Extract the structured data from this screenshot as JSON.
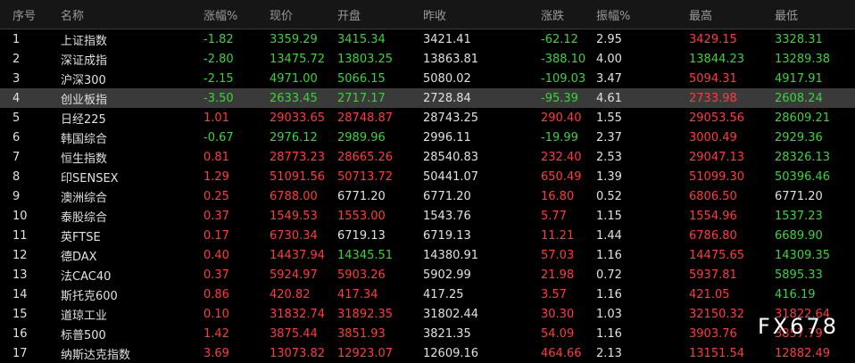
{
  "headers": [
    "序号",
    "名称",
    "涨幅%",
    "现价",
    "开盘",
    "昨收",
    "涨跌",
    "振幅%",
    "最高",
    "最低"
  ],
  "colors": {
    "up": "#ff3b3b",
    "down": "#3cd23c",
    "flat": "#e0e0e0",
    "selected_row": "#3a3a3a"
  },
  "watermark": "FX678",
  "rows": [
    {
      "idx": "1",
      "name": "上证指数",
      "chg": "-1.82",
      "price": "3359.29",
      "open": "3415.34",
      "prev": "3421.41",
      "diff": "-62.12",
      "amp": "2.95",
      "high": "3429.15",
      "low": "3328.31"
    },
    {
      "idx": "2",
      "name": "深证成指",
      "chg": "-2.80",
      "price": "13475.72",
      "open": "13803.25",
      "prev": "13863.81",
      "diff": "-388.10",
      "amp": "4.00",
      "high": "13844.23",
      "low": "13289.38"
    },
    {
      "idx": "3",
      "name": "沪深300",
      "chg": "-2.15",
      "price": "4971.00",
      "open": "5066.15",
      "prev": "5080.02",
      "diff": "-109.03",
      "amp": "3.47",
      "high": "5094.31",
      "low": "4917.91"
    },
    {
      "idx": "4",
      "name": "创业板指",
      "chg": "-3.50",
      "price": "2633.45",
      "open": "2717.17",
      "prev": "2728.84",
      "diff": "-95.39",
      "amp": "4.61",
      "high": "2733.98",
      "low": "2608.24"
    },
    {
      "idx": "5",
      "name": "日经225",
      "chg": "1.01",
      "price": "29033.65",
      "open": "28748.87",
      "prev": "28743.25",
      "diff": "290.40",
      "amp": "1.55",
      "high": "29053.56",
      "low": "28609.21"
    },
    {
      "idx": "6",
      "name": "韩国综合",
      "chg": "-0.67",
      "price": "2976.12",
      "open": "2989.96",
      "prev": "2996.11",
      "diff": "-19.99",
      "amp": "2.37",
      "high": "3000.49",
      "low": "2929.36"
    },
    {
      "idx": "7",
      "name": "恒生指数",
      "chg": "0.81",
      "price": "28773.23",
      "open": "28665.26",
      "prev": "28540.83",
      "diff": "232.40",
      "amp": "2.53",
      "high": "29047.13",
      "low": "28326.13"
    },
    {
      "idx": "8",
      "name": "印SENSEX",
      "chg": "1.29",
      "price": "51091.56",
      "open": "50713.72",
      "prev": "50441.07",
      "diff": "650.49",
      "amp": "1.39",
      "high": "51099.30",
      "low": "50396.46"
    },
    {
      "idx": "9",
      "name": "澳洲综合",
      "chg": "0.25",
      "price": "6788.00",
      "open": "6771.20",
      "prev": "6771.20",
      "diff": "16.80",
      "amp": "0.52",
      "high": "6806.50",
      "low": "6771.20"
    },
    {
      "idx": "10",
      "name": "泰股综合",
      "chg": "0.37",
      "price": "1549.53",
      "open": "1553.00",
      "prev": "1543.76",
      "diff": "5.77",
      "amp": "1.15",
      "high": "1554.96",
      "low": "1537.23"
    },
    {
      "idx": "11",
      "name": "英FTSE",
      "chg": "0.17",
      "price": "6730.34",
      "open": "6719.13",
      "prev": "6719.13",
      "diff": "11.21",
      "amp": "1.44",
      "high": "6786.80",
      "low": "6689.90"
    },
    {
      "idx": "12",
      "name": "德DAX",
      "chg": "0.40",
      "price": "14437.94",
      "open": "14345.51",
      "prev": "14380.91",
      "diff": "57.03",
      "amp": "1.16",
      "high": "14475.65",
      "low": "14309.35"
    },
    {
      "idx": "13",
      "name": "法CAC40",
      "chg": "0.37",
      "price": "5924.97",
      "open": "5903.26",
      "prev": "5902.99",
      "diff": "21.98",
      "amp": "0.72",
      "high": "5937.81",
      "low": "5895.33"
    },
    {
      "idx": "14",
      "name": "斯托克600",
      "chg": "0.86",
      "price": "420.82",
      "open": "417.34",
      "prev": "417.25",
      "diff": "3.57",
      "amp": "1.16",
      "high": "421.05",
      "low": "416.19"
    },
    {
      "idx": "15",
      "name": "道琼工业",
      "chg": "0.10",
      "price": "31832.74",
      "open": "31892.35",
      "prev": "31802.44",
      "diff": "30.30",
      "amp": "1.03",
      "high": "32150.32",
      "low": "31822.64"
    },
    {
      "idx": "16",
      "name": "标普500",
      "chg": "1.42",
      "price": "3875.44",
      "open": "3851.93",
      "prev": "3821.35",
      "diff": "54.09",
      "amp": "1.16",
      "high": "3903.76",
      "low": "3857.79"
    },
    {
      "idx": "17",
      "name": "纳斯达克指数",
      "chg": "3.69",
      "price": "13073.82",
      "open": "12923.07",
      "prev": "12609.16",
      "diff": "464.66",
      "amp": "2.13",
      "high": "13151.54",
      "low": "12882.49"
    }
  ]
}
